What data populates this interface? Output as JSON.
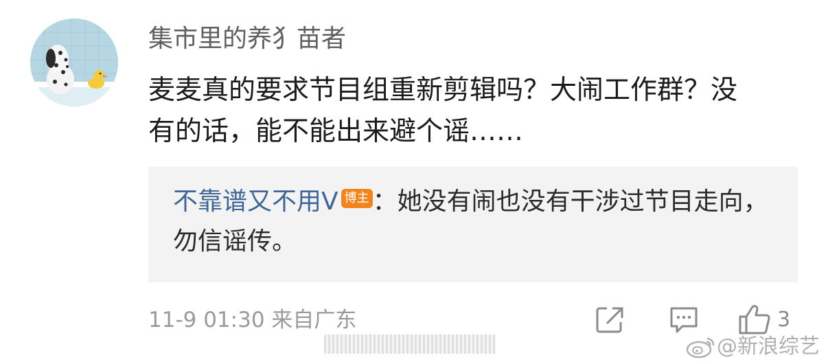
{
  "comment": {
    "username": "集市里的养犭苗者",
    "text": "麦麦真的要求节目组重新剪辑吗？大闹工作群？没有的话，能不能出来避个谣……",
    "reply": {
      "username": "不靠谱又不用V",
      "badge": "博主",
      "separator": "：",
      "text": "她没有闹也没有干涉过节目走向，勿信谣传。"
    },
    "meta": "11-9 01:30 来自广东",
    "actions": {
      "share_icon": "share-icon",
      "comment_icon": "comment-icon",
      "like_icon": "thumbs-up-icon",
      "like_count": "3"
    }
  },
  "watermark": {
    "icon": "weibo-logo-icon",
    "text": "@新浪综艺"
  },
  "colors": {
    "username": "#5f5f5f",
    "reply_username": "#3e6596",
    "badge_bg": "#f2841f",
    "reply_bg": "#f3f3f3",
    "muted": "#9a9a9a"
  }
}
